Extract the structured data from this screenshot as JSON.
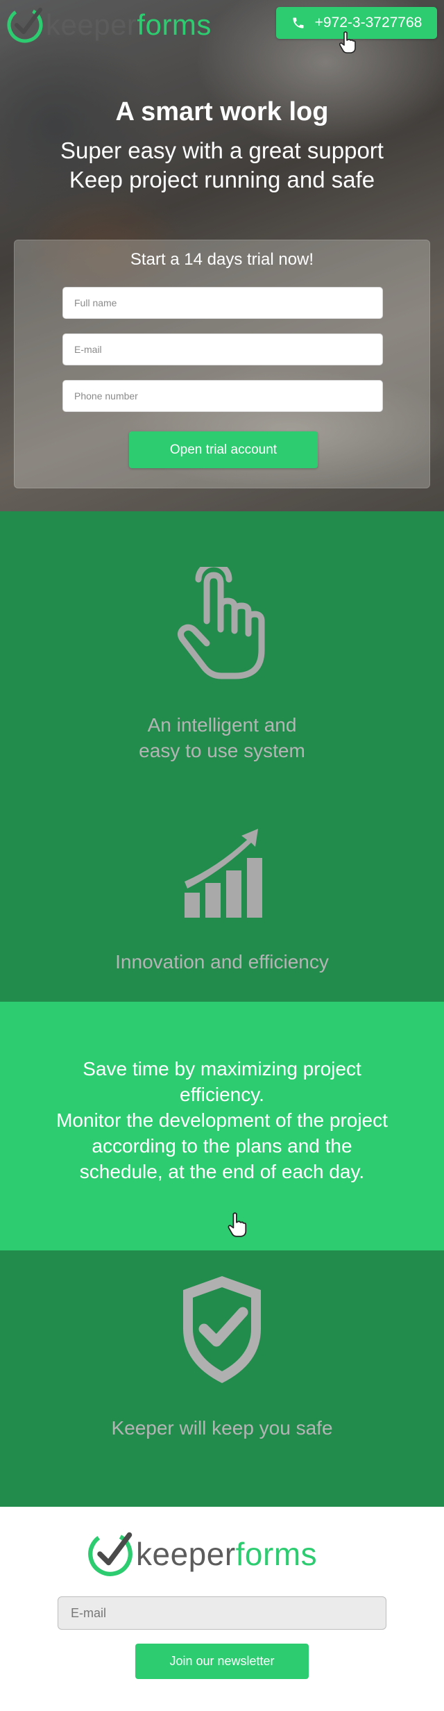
{
  "brand": {
    "logo_part1": "keeper",
    "logo_part2": "forms",
    "accent": "#2ecc71",
    "dark_green": "#218c4c"
  },
  "header": {
    "phone_label": "+972-3-3727768",
    "phone_icon": "phone-icon"
  },
  "hero": {
    "title": "A smart work log",
    "subtitle_line1": "Super easy with a great support",
    "subtitle_line2": "Keep project running and safe"
  },
  "trial_form": {
    "title": "Start a 14 days trial now!",
    "full_name_placeholder": "Full name",
    "email_placeholder": "E-mail",
    "phone_placeholder": "Phone number",
    "submit_label": "Open trial account"
  },
  "features": [
    {
      "icon": "pointing-hand-icon",
      "line1": "An intelligent and",
      "line2": "easy to use system"
    },
    {
      "icon": "growth-chart-icon",
      "line1": "Innovation and efficiency"
    }
  ],
  "band": {
    "lines": [
      "Save time by maximizing project",
      "efficiency.",
      "Monitor the development of the project",
      "according to the plans and the",
      "schedule, at the end of each day."
    ]
  },
  "safe": {
    "icon": "shield-check-icon",
    "text": "Keeper will keep you safe"
  },
  "newsletter": {
    "email_placeholder": "E-mail",
    "submit_label": "Join our newsletter"
  }
}
